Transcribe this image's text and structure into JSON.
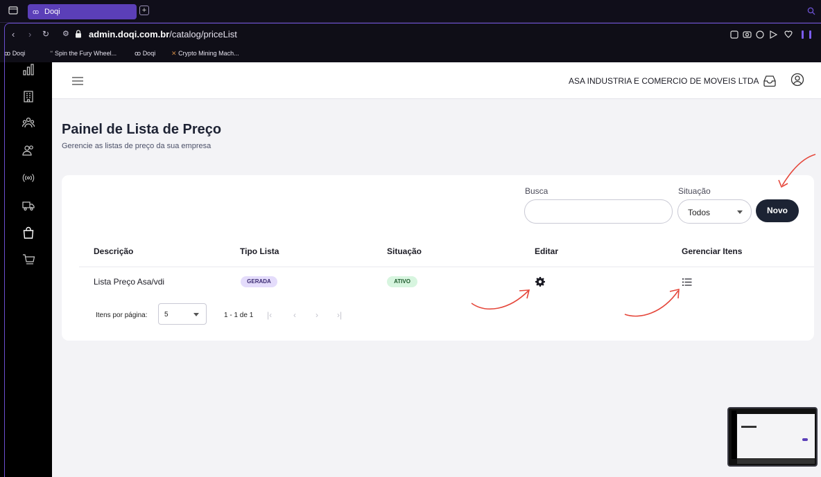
{
  "browser": {
    "tab_title": "Doqi",
    "tab_favicon": "ꝏ",
    "url_host": "admin.doqi.com.br",
    "url_path": "/catalog/priceList",
    "bookmarks": [
      {
        "icon": "ꝏ",
        "label": "Doqi"
      },
      {
        "icon": "🙶",
        "label": "Spin the Fury Wheel..."
      },
      {
        "icon": "ꝏ",
        "label": "Doqi"
      },
      {
        "icon": "✕",
        "label": "Crypto Mining Mach..."
      }
    ]
  },
  "header": {
    "company": "ASA INDUSTRIA E COMERCIO DE MOVEIS LTDA"
  },
  "page": {
    "title": "Painel de Lista de Preço",
    "subtitle": "Gerencie as listas de preço da sua empresa"
  },
  "filters": {
    "search_label": "Busca",
    "search_value": "",
    "status_label": "Situação",
    "status_value": "Todos",
    "new_button": "Novo"
  },
  "table": {
    "columns": [
      "Descrição",
      "Tipo Lista",
      "Situação",
      "Editar",
      "Gerenciar Itens"
    ],
    "rows": [
      {
        "descricao": "Lista Preço Asa/vdi",
        "tipo": "GERADA",
        "situacao": "ATIVO"
      }
    ]
  },
  "pagination": {
    "items_label": "Itens por página:",
    "page_size": "5",
    "range": "1 - 1 de 1"
  },
  "colors": {
    "accent": "#5b3fb8",
    "primary_button": "#1c2333",
    "chip_gerada_bg": "#e4dcfb",
    "chip_ativo_bg": "#d7f5df",
    "annotation_arrow": "#e5473b"
  }
}
